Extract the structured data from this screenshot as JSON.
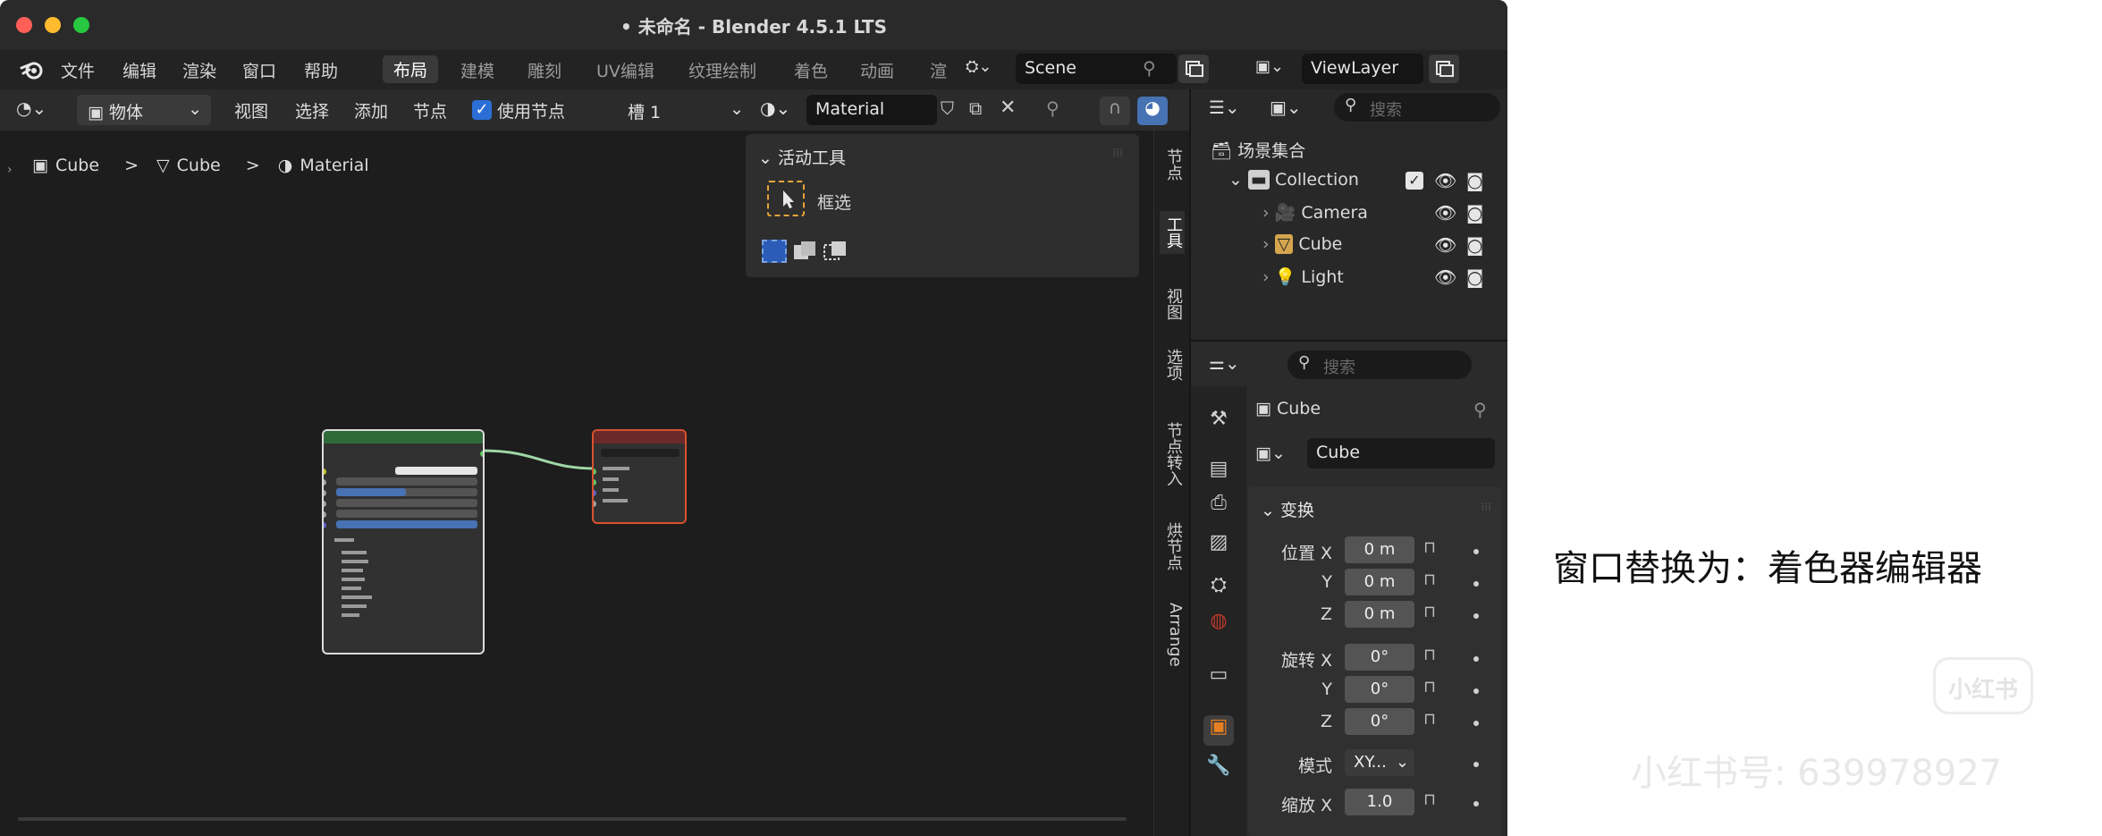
{
  "window": {
    "title": "• 未命名 - Blender 4.5.1 LTS"
  },
  "menu": {
    "items": [
      "文件",
      "编辑",
      "渲染",
      "窗口",
      "帮助"
    ]
  },
  "workspaces": {
    "tabs": [
      "布局",
      "建模",
      "雕刻",
      "UV编辑",
      "纹理绘制",
      "着色",
      "动画",
      "渲"
    ],
    "active": "布局"
  },
  "scene": {
    "name": "Scene"
  },
  "view_layer": {
    "name": "ViewLayer"
  },
  "node_header": {
    "mode": "物体",
    "menus": [
      "视图",
      "选择",
      "添加",
      "节点"
    ],
    "use_nodes_label": "使用节点",
    "slot": "槽 1",
    "material": "Material"
  },
  "breadcrumb": {
    "items": [
      "Cube",
      "Cube",
      "Material"
    ]
  },
  "active_tool": {
    "title": "活动工具",
    "tool": "框选"
  },
  "side_tabs": [
    "节点",
    "工具",
    "视图",
    "选项",
    "节点转入",
    "烘节点",
    "Arrange"
  ],
  "outliner": {
    "search_placeholder": "搜索",
    "root": "场景集合",
    "collection": "Collection",
    "items": [
      "Camera",
      "Cube",
      "Light"
    ]
  },
  "properties": {
    "search_placeholder": "搜索",
    "object_name": "Cube",
    "data_name": "Cube",
    "section": "变换",
    "location_label": "位置 X",
    "location": [
      "0 m",
      "0 m",
      "0 m"
    ],
    "rotation_label": "旋转 X",
    "rotation": [
      "0°",
      "0°",
      "0°"
    ],
    "axis_y": "Y",
    "axis_z": "Z",
    "mode_label": "模式",
    "mode_value": "XY...",
    "scale_label": "缩放 X",
    "scale_x": "1.0"
  },
  "annotation": "窗口替换为：着色器编辑器",
  "watermark": {
    "logo": "小红书",
    "text": "小红书号: 639978927"
  },
  "colors": {
    "traffic_red": "#ff5f57",
    "traffic_yellow": "#febc2e",
    "traffic_green": "#28c840",
    "bsdf_header": "#2f6b3a",
    "output_header": "#6b2a2a",
    "node_border": "#dcdcdc",
    "link": "#9fd7a4",
    "accent_blue": "#4772b3",
    "checkbox_blue": "#2b6fd6"
  }
}
